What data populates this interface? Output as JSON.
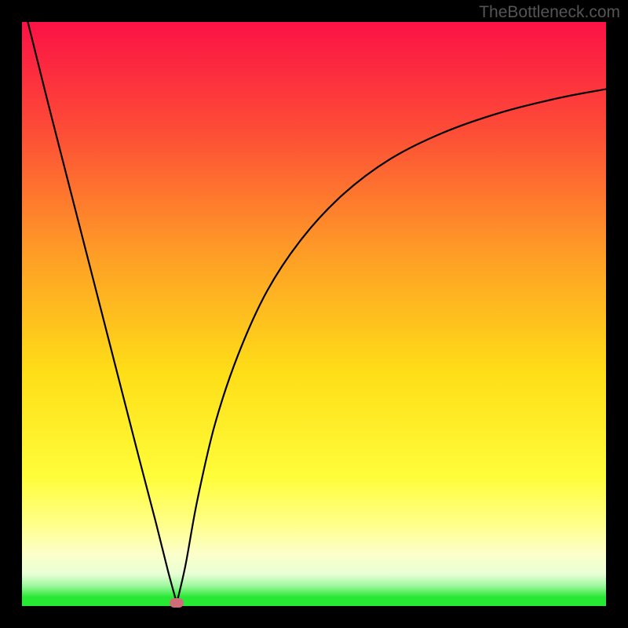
{
  "watermark": "TheBottleneck.com",
  "colors": {
    "frame": "#000000",
    "top": "#fc1246",
    "mid_upper": "#fd8a2b",
    "mid": "#fede17",
    "light": "#ffff8a",
    "pale": "#f7ffcf",
    "green": "#27e833",
    "curve": "#000000",
    "marker": "#cf6d7a"
  },
  "chart_data": {
    "type": "line",
    "title": "",
    "xlabel": "",
    "ylabel": "",
    "xlim": [
      0,
      100
    ],
    "ylim": [
      0,
      100
    ],
    "gradient_stops": [
      {
        "offset": 0.0,
        "color": "#fc1246"
      },
      {
        "offset": 0.18,
        "color": "#fd4a37"
      },
      {
        "offset": 0.4,
        "color": "#fe9e26"
      },
      {
        "offset": 0.6,
        "color": "#fede17"
      },
      {
        "offset": 0.78,
        "color": "#fffd3a"
      },
      {
        "offset": 0.86,
        "color": "#ffff8a"
      },
      {
        "offset": 0.91,
        "color": "#fcffc9"
      },
      {
        "offset": 0.945,
        "color": "#e9ffd6"
      },
      {
        "offset": 0.965,
        "color": "#a0f8a0"
      },
      {
        "offset": 0.985,
        "color": "#27e833"
      },
      {
        "offset": 1.0,
        "color": "#27e833"
      }
    ],
    "series": [
      {
        "name": "left-branch",
        "x": [
          1,
          5,
          10,
          15,
          20,
          23,
          25,
          26.5
        ],
        "y": [
          100,
          84,
          64.5,
          45,
          25.5,
          14,
          6,
          0.5
        ]
      },
      {
        "name": "right-branch",
        "x": [
          26.5,
          28,
          30,
          33,
          37,
          42,
          48,
          55,
          63,
          72,
          82,
          92,
          100
        ],
        "y": [
          0.5,
          7,
          18,
          31,
          43,
          54,
          63,
          70.5,
          76.5,
          81,
          84.5,
          87,
          88.5
        ]
      }
    ],
    "marker": {
      "x": 26.5,
      "y": 0.5
    },
    "annotations": []
  }
}
